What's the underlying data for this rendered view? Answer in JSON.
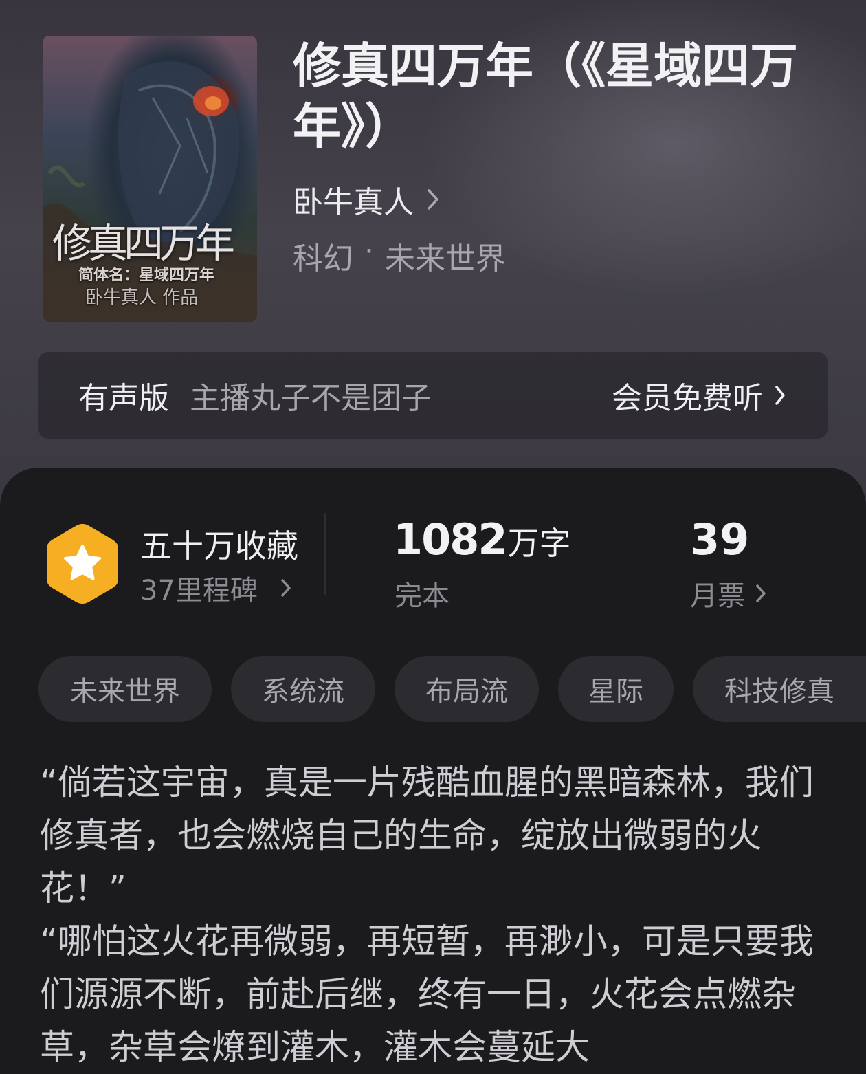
{
  "book": {
    "title": "修真四万年（《星域四万年》）",
    "author": "卧牛真人",
    "category": "科幻",
    "separator": "·",
    "subcategory": "未来世界",
    "cover": {
      "title": "修真四万年",
      "subtitle": "简体名：星域四万年",
      "byline": "卧牛真人  作品"
    }
  },
  "audio": {
    "label": "有声版",
    "host": "主播丸子不是团子",
    "cta": "会员免费听"
  },
  "stats": {
    "favorites_title": "五十万收藏",
    "milestones": "37里程碑",
    "word_count": "1082",
    "word_unit": "万字",
    "status": "完本",
    "monthly_tickets": "39",
    "monthly_tickets_label": "月票"
  },
  "tags": [
    "未来世界",
    "系统流",
    "布局流",
    "星际",
    "科技修真"
  ],
  "synopsis": [
    "“倘若这宇宙，真是一片残酷血腥的黑暗森林，我们修真者，也会燃烧自己的生命，绽放出微弱的火花！”",
    "“哪怕这火花再微弱，再短暂，再渺小，可是只要我们源源不断，前赴后继，终有一日，火花会点燃杂草，杂草会燎到灌木，灌木会蔓延大"
  ],
  "colors": {
    "badge": "#f6b023",
    "badge_dark": "#f39a1d",
    "text_primary": "#f2f2f4",
    "text_secondary": "#8d8a92",
    "tag_bg": "#2c2b30"
  },
  "icons": [
    "chevron-right-icon",
    "star-badge-icon"
  ]
}
